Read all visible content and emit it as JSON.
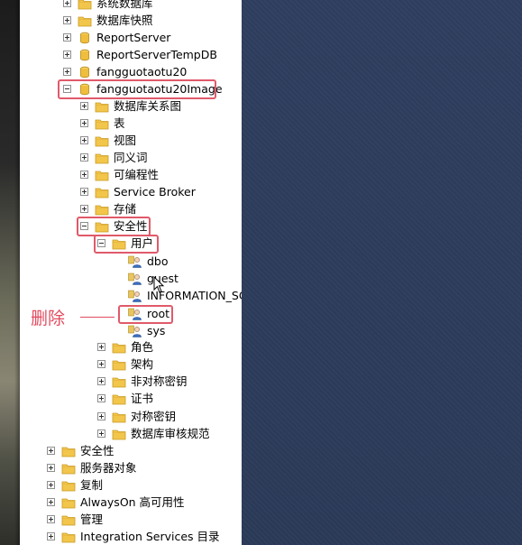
{
  "tree": {
    "nodes": [
      {
        "id": "sys-db",
        "label": "系统数据库",
        "expander": "plus",
        "icon": "folder-icon"
      },
      {
        "id": "db-snapshot",
        "label": "数据库快照",
        "expander": "plus",
        "icon": "folder-icon"
      },
      {
        "id": "reportserver",
        "label": "ReportServer",
        "expander": "plus",
        "icon": "database-icon"
      },
      {
        "id": "reportservertempdb",
        "label": "ReportServerTempDB",
        "expander": "plus",
        "icon": "database-icon"
      },
      {
        "id": "fangguotaotu20",
        "label": "fangguotaotu20",
        "expander": "plus",
        "icon": "database-icon"
      },
      {
        "id": "fangguotaotu20image",
        "label": "fangguotaotu20Image",
        "expander": "minus",
        "icon": "database-icon"
      },
      {
        "id": "db-diagrams",
        "label": "数据库关系图",
        "expander": "plus",
        "icon": "folder-icon"
      },
      {
        "id": "tables",
        "label": "表",
        "expander": "plus",
        "icon": "folder-icon"
      },
      {
        "id": "views",
        "label": "视图",
        "expander": "plus",
        "icon": "folder-icon"
      },
      {
        "id": "synonyms",
        "label": "同义词",
        "expander": "plus",
        "icon": "folder-icon"
      },
      {
        "id": "programmability",
        "label": "可编程性",
        "expander": "plus",
        "icon": "folder-icon"
      },
      {
        "id": "service-broker",
        "label": "Service Broker",
        "expander": "plus",
        "icon": "folder-icon"
      },
      {
        "id": "storage",
        "label": "存储",
        "expander": "plus",
        "icon": "folder-icon"
      },
      {
        "id": "security-db",
        "label": "安全性",
        "expander": "minus",
        "icon": "folder-icon"
      },
      {
        "id": "users",
        "label": "用户",
        "expander": "minus",
        "icon": "folder-icon"
      },
      {
        "id": "user-dbo",
        "label": "dbo",
        "expander": "none",
        "icon": "user-icon"
      },
      {
        "id": "user-guest",
        "label": "guest",
        "expander": "none",
        "icon": "user-icon"
      },
      {
        "id": "user-info-schema",
        "label": "INFORMATION_SCHEMA",
        "expander": "none",
        "icon": "user-icon"
      },
      {
        "id": "user-root",
        "label": "root",
        "expander": "none",
        "icon": "user-icon"
      },
      {
        "id": "user-sys",
        "label": "sys",
        "expander": "none",
        "icon": "user-icon"
      },
      {
        "id": "roles",
        "label": "角色",
        "expander": "plus",
        "icon": "folder-icon"
      },
      {
        "id": "schemas",
        "label": "架构",
        "expander": "plus",
        "icon": "folder-icon"
      },
      {
        "id": "asym-keys",
        "label": "非对称密钥",
        "expander": "plus",
        "icon": "folder-icon"
      },
      {
        "id": "certs",
        "label": "证书",
        "expander": "plus",
        "icon": "folder-icon"
      },
      {
        "id": "sym-keys",
        "label": "对称密钥",
        "expander": "plus",
        "icon": "folder-icon"
      },
      {
        "id": "db-audit",
        "label": "数据库审核规范",
        "expander": "plus",
        "icon": "folder-icon"
      },
      {
        "id": "security-server",
        "label": "安全性",
        "expander": "plus",
        "icon": "folder-icon"
      },
      {
        "id": "server-objects",
        "label": "服务器对象",
        "expander": "plus",
        "icon": "folder-icon"
      },
      {
        "id": "replication",
        "label": "复制",
        "expander": "plus",
        "icon": "folder-icon"
      },
      {
        "id": "alwayson",
        "label": "AlwaysOn 高可用性",
        "expander": "plus",
        "icon": "folder-icon"
      },
      {
        "id": "management",
        "label": "管理",
        "expander": "plus",
        "icon": "folder-icon"
      },
      {
        "id": "integration-services",
        "label": "Integration Services 目录",
        "expander": "plus",
        "icon": "folder-icon"
      }
    ]
  },
  "annotation": {
    "text": "删除",
    "color": "#e24b5f"
  },
  "colors": {
    "highlight": "#e05a6a",
    "background": "#2f3f5e"
  }
}
